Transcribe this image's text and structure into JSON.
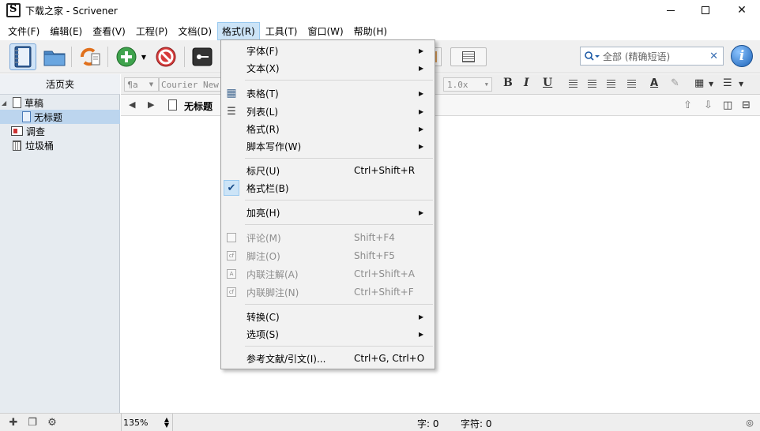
{
  "window": {
    "title": "下载之家 - Scrivener"
  },
  "menubar": {
    "items": [
      "文件(F)",
      "编辑(E)",
      "查看(V)",
      "工程(P)",
      "文档(D)",
      "格式(R)",
      "工具(T)",
      "窗口(W)",
      "帮助(H)"
    ],
    "active_index": 5
  },
  "toolbar": {
    "search": {
      "placeholder": "全部 (精确短语)"
    }
  },
  "binder": {
    "header": "活页夹",
    "items": [
      {
        "label": "草稿",
        "expanded": true
      },
      {
        "label": "无标题",
        "selected": true
      },
      {
        "label": "调查"
      },
      {
        "label": "垃圾桶"
      }
    ]
  },
  "formatbar": {
    "style": "¶a",
    "font": "Courier New",
    "line_spacing": "1.0x"
  },
  "editor": {
    "doc_title": "无标题"
  },
  "statusbar": {
    "zoom": "135%",
    "word_count": "字: 0",
    "char_count": "字符: 0"
  },
  "format_menu": {
    "items": [
      {
        "label": "字体(F)",
        "submenu": true
      },
      {
        "label": "文本(X)",
        "submenu": true
      },
      {
        "label": "表格(T)",
        "submenu": true,
        "icon": "table-icon"
      },
      {
        "label": "列表(L)",
        "submenu": true,
        "icon": "list-icon"
      },
      {
        "label": "格式(R)",
        "submenu": true
      },
      {
        "label": "脚本写作(W)",
        "submenu": true
      },
      {
        "label": "标尺(U)",
        "shortcut": "Ctrl+Shift+R"
      },
      {
        "label": "格式栏(B)",
        "checked": true
      },
      {
        "label": "加亮(H)",
        "submenu": true
      },
      {
        "label": "评论(M)",
        "shortcut": "Shift+F4",
        "disabled": true,
        "icon": "comment-icon"
      },
      {
        "label": "脚注(O)",
        "shortcut": "Shift+F5",
        "disabled": true,
        "icon": "footnote-icon"
      },
      {
        "label": "内联注解(A)",
        "shortcut": "Ctrl+Shift+A",
        "disabled": true,
        "icon": "inline-annotation-icon"
      },
      {
        "label": "内联脚注(N)",
        "shortcut": "Ctrl+Shift+F",
        "disabled": true,
        "icon": "inline-footnote-icon"
      },
      {
        "label": "转换(C)",
        "submenu": true
      },
      {
        "label": "选项(S)",
        "submenu": true
      },
      {
        "label": "参考文献/引文(I)...",
        "shortcut": "Ctrl+G, Ctrl+O"
      }
    ]
  },
  "colors": {
    "accent": "#cce4f7",
    "binder_bg": "#e6ebf0",
    "selection": "#bcd5ee"
  }
}
